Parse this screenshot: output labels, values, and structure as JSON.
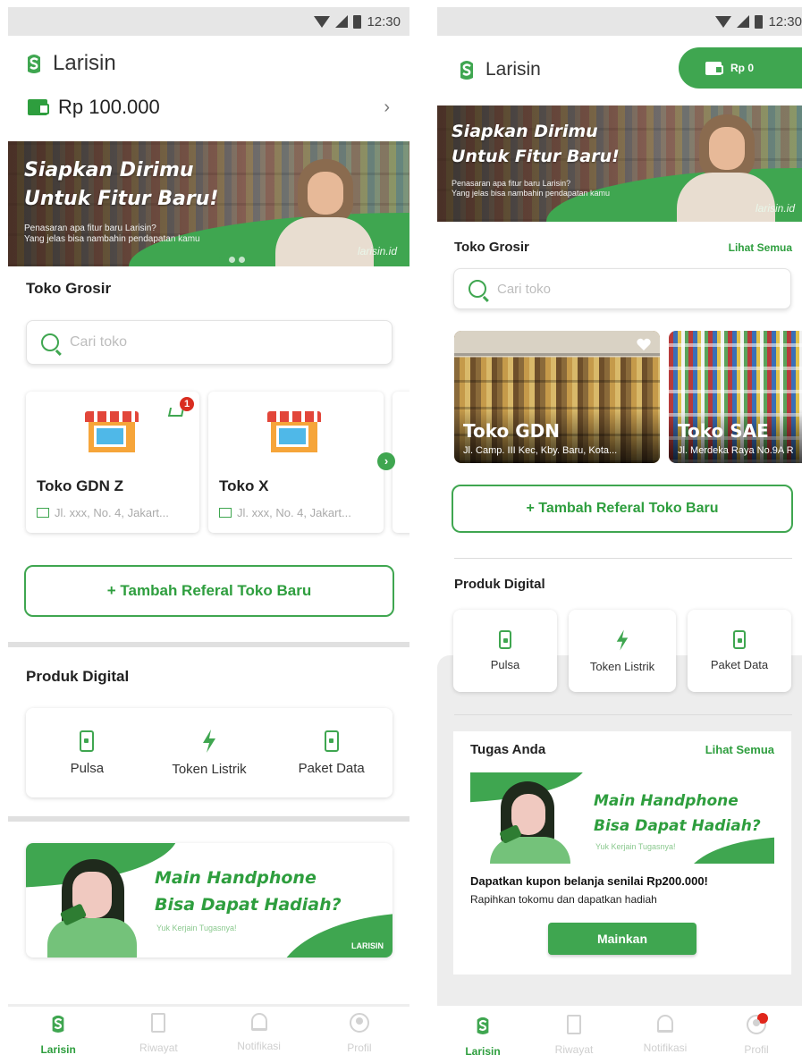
{
  "status_bar": {
    "time": "12:30"
  },
  "app": {
    "name": "Larisin"
  },
  "screen1": {
    "balance": "Rp 100.000",
    "banner": {
      "headline_line1": "Siapkan Dirimu",
      "headline_line2": "Untuk Fitur Baru!",
      "sub_line1": "Penasaran apa fitur baru Larisin?",
      "sub_line2": "Yang jelas bisa nambahin pendapatan kamu",
      "site": "larisin.id",
      "dots": 3,
      "active_dot": 1
    },
    "stores_title": "Toko Grosir",
    "search_placeholder": "Cari toko",
    "stores": [
      {
        "name": "Toko GDN Z",
        "address": "Jl. xxx, No. 4, Jakart...",
        "cart_badge": "1"
      },
      {
        "name": "Toko X",
        "address": "Jl. xxx, No. 4, Jakart..."
      }
    ],
    "add_referral": "+ Tambah Referal Toko Baru",
    "digital_title": "Produk Digital",
    "digital_items": [
      "Pulsa",
      "Token Listrik",
      "Paket Data"
    ],
    "promo": {
      "line1": "Main Handphone",
      "line2": "Bisa Dapat Hadiah?",
      "sub": "Yuk Kerjain Tugasnya!",
      "brand": "LARISIN"
    }
  },
  "screen2": {
    "balance": "Rp 0",
    "banner": {
      "headline_line1": "Siapkan Dirimu",
      "headline_line2": "Untuk Fitur Baru!",
      "sub_line1": "Penasaran apa fitur baru Larisin?",
      "sub_line2": "Yang jelas bisa nambahin pendapatan kamu",
      "site": "larisin.id"
    },
    "stores_title": "Toko Grosir",
    "see_all": "Lihat Semua",
    "search_placeholder": "Cari toko",
    "stores": [
      {
        "name": "Toko GDN",
        "address": "Jl. Camp. III Kec, Kby. Baru, Kota..."
      },
      {
        "name": "Toko SAE",
        "address": "Jl. Merdeka Raya No.9A R"
      }
    ],
    "add_referral": "+ Tambah Referal Toko Baru",
    "digital_title": "Produk Digital",
    "digital_items": [
      "Pulsa",
      "Token Listrik",
      "Paket Data"
    ],
    "tasks": {
      "title": "Tugas Anda",
      "see_all": "Lihat Semua",
      "promo_line1": "Main Handphone",
      "promo_line2": "Bisa Dapat Hadiah?",
      "promo_sub": "Yuk Kerjain Tugasnya!",
      "headline": "Dapatkan kupon belanja senilai Rp200.000!",
      "desc": "Rapihkan tokomu dan dapatkan hadiah",
      "button": "Mainkan"
    }
  },
  "bottom_nav": [
    "Larisin",
    "Riwayat",
    "Notifikasi",
    "Profil"
  ],
  "colors": {
    "brand_green": "#3fa650",
    "badge_red": "#d92d20",
    "inactive": "#cfcfcf"
  }
}
